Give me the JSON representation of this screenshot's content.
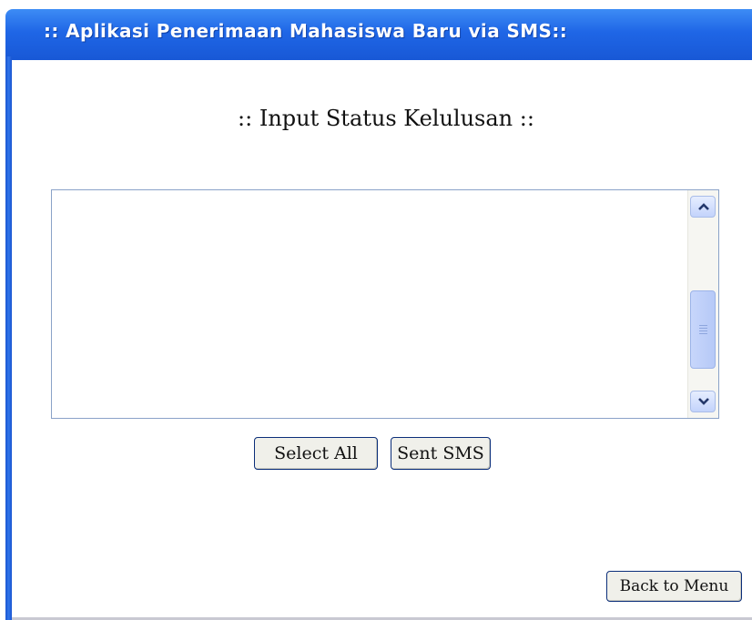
{
  "window": {
    "title": ":: Aplikasi Penerimaan Mahasiswa Baru via SMS::"
  },
  "main": {
    "heading": ":: Input Status Kelulusan  ::",
    "textarea_value": ""
  },
  "buttons": {
    "select_all": "Select All",
    "sent_sms": "Sent SMS",
    "back_to_menu": "Back to Menu"
  },
  "icons": {
    "scroll_up": "chevron-up-icon",
    "scroll_down": "chevron-down-icon"
  },
  "colors": {
    "titlebar": "#1f66e6",
    "button_border": "#0b2e7a"
  }
}
